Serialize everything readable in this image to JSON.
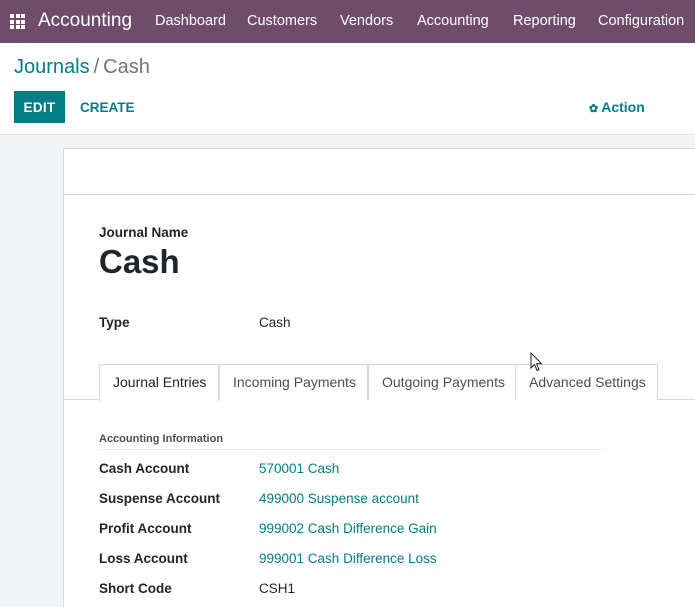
{
  "navbar": {
    "brand": "Accounting",
    "menu": [
      "Dashboard",
      "Customers",
      "Vendors",
      "Accounting",
      "Reporting",
      "Configuration"
    ]
  },
  "breadcrumb": {
    "parent": "Journals",
    "separator": "/",
    "current": "Cash"
  },
  "buttons": {
    "edit": "EDIT",
    "create": "CREATE",
    "action": "Action"
  },
  "form": {
    "name_caption": "Journal Name",
    "name": "Cash",
    "type_label": "Type",
    "type_value": "Cash"
  },
  "tabs": [
    "Journal Entries",
    "Incoming Payments",
    "Outgoing Payments",
    "Advanced Settings"
  ],
  "active_tab": "Journal Entries",
  "accounting_info": {
    "title": "Accounting Information",
    "rows": [
      {
        "label": "Cash Account",
        "value": "570001 Cash"
      },
      {
        "label": "Suspense Account",
        "value": "499000 Suspense account"
      },
      {
        "label": "Profit Account",
        "value": "999002 Cash Difference Gain"
      },
      {
        "label": "Loss Account",
        "value": "999001 Cash Difference Loss"
      },
      {
        "label": "Short Code",
        "value": "CSH1"
      }
    ]
  },
  "colors": {
    "navbar": "#6f4c6b",
    "primary": "#017e84"
  },
  "icons": {
    "apps": "apps-grid-icon",
    "action": "gear-icon"
  }
}
